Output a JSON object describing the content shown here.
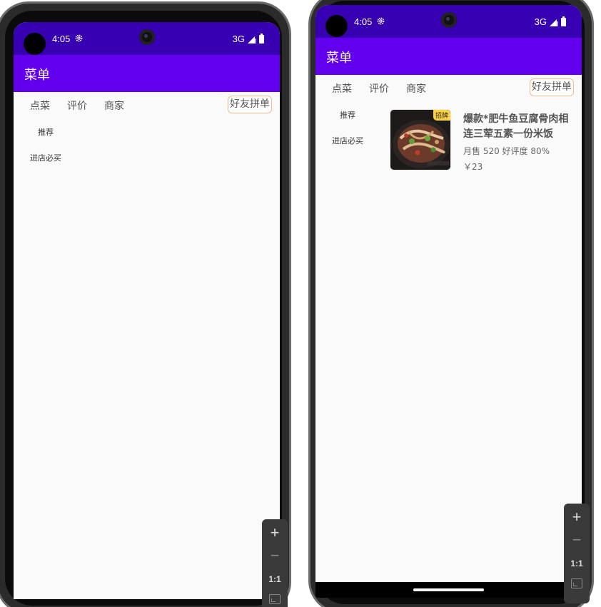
{
  "status_bar": {
    "time": "4:05",
    "network": "3G"
  },
  "app_bar": {
    "title": "菜单"
  },
  "tabs": [
    {
      "label": "点菜"
    },
    {
      "label": "评价"
    },
    {
      "label": "商家"
    }
  ],
  "group_order_button": {
    "label": "好友拼单"
  },
  "categories": [
    {
      "label": "推荐"
    },
    {
      "label": "进店必买"
    }
  ],
  "dish": {
    "name": "爆款*肥牛鱼豆腐骨肉相连三荤五素一份米饭",
    "badge": "招牌",
    "meta": "月售 520 好评度 80%",
    "price": "￥23"
  },
  "zoom_controls": {
    "zoom_in": "+",
    "zoom_out": "−",
    "reset": "1:1"
  },
  "colors": {
    "status_bar": "#3700b3",
    "app_bar": "#6200ee",
    "accent_border": "#f1b98e",
    "badge": "#ffd23f"
  }
}
